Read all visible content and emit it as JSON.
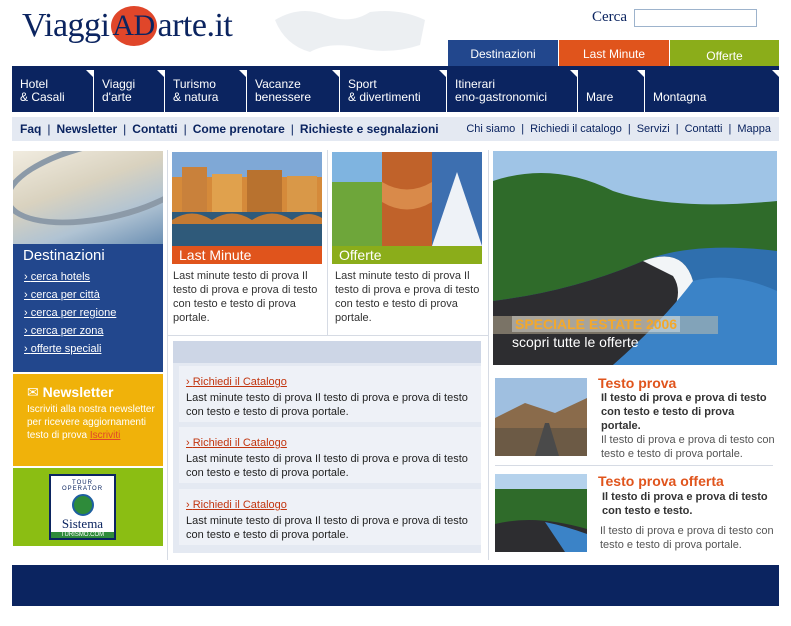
{
  "header": {
    "logo_left": "Viaggi",
    "logo_badge": "AD",
    "logo_right": "arte.it",
    "search_label": "Cerca",
    "search_value": ""
  },
  "top_tabs": [
    {
      "label": "Destinazioni",
      "color": "#22478d"
    },
    {
      "label": "Last Minute",
      "color": "#e0541c"
    },
    {
      "label": "Offerte",
      "color": "#8bad1a"
    }
  ],
  "main_nav": [
    {
      "line1": "Hotel",
      "line2": "& Casali"
    },
    {
      "line1": "Viaggi",
      "line2": "d'arte"
    },
    {
      "line1": "Turismo",
      "line2": "& natura"
    },
    {
      "line1": "Vacanze",
      "line2": "benessere"
    },
    {
      "line1": "Sport",
      "line2": "& divertimenti"
    },
    {
      "line1": "Itinerari",
      "line2": "eno-gastronomici"
    },
    {
      "line1": "Mare",
      "line2": ""
    },
    {
      "line1": "Montagna",
      "line2": ""
    }
  ],
  "sub_nav_left": [
    "Faq",
    "Newsletter",
    "Contatti",
    "Come prenotare",
    "Richieste e segnalazioni"
  ],
  "sub_nav_right": [
    "Chi siamo",
    "Richiedi il catalogo",
    "Servizi",
    "Contatti",
    "Mappa"
  ],
  "sidebar": {
    "destinazioni_title": "Destinazioni",
    "links": [
      "cerca hotels",
      "cerca per città",
      "cerca per regione",
      "cerca per zona",
      "offerte speciali"
    ],
    "newsletter_title": "Newsletter",
    "newsletter_text": "Iscriviti alla nostra newsletter per ricevere aggiornamenti testo di prova",
    "newsletter_link": "Iscriviti",
    "sponsor_top": "TOUR OPERATOR",
    "sponsor_name": "Sistema",
    "sponsor_sub": "TURISMO.COM"
  },
  "promos": [
    {
      "label": "Last Minute",
      "color": "#e0541c",
      "text": "Last minute testo di prova Il testo di prova e prova di testo con testo e testo di prova portale."
    },
    {
      "label": "Offerte",
      "color": "#8bad1a",
      "text": "Last minute testo di prova Il testo di prova e prova di testo con testo e testo di prova portale."
    }
  ],
  "catalog_items": [
    {
      "link": "Richiedi il Catalogo",
      "text": "Last minute testo di prova Il testo di prova e prova di testo con testo e testo di prova portale."
    },
    {
      "link": "Richiedi il Catalogo",
      "text": "Last minute testo di prova Il testo di prova e prova di testo con testo e testo di prova portale."
    },
    {
      "link": "Richiedi il Catalogo",
      "text": "Last minute testo di prova Il testo di prova e prova di testo con testo e testo di prova portale."
    }
  ],
  "banner": {
    "line1": "SPECIALE ESTATE 2006",
    "line2": "scopri tutte le offerte"
  },
  "right_items": [
    {
      "title": "Testo prova",
      "bold": "Il testo di prova e prova di testo con testo e testo di prova portale.",
      "text": "Il testo di prova e prova di testo con testo e testo di prova portale."
    },
    {
      "title": "Testo prova offerta",
      "bold": "Il testo di prova e prova di testo con testo e testo.",
      "text": "Il testo di prova e prova di testo con testo e testo di prova portale."
    }
  ]
}
